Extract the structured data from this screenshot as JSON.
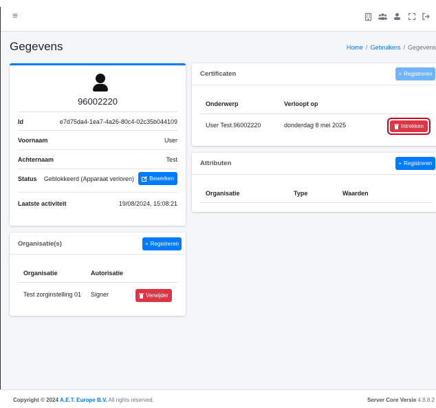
{
  "navbar": {
    "menu_icon": "≡",
    "icons": [
      {
        "name": "building-icon",
        "glyph": "▯"
      },
      {
        "name": "users-icon",
        "glyph": "👥"
      },
      {
        "name": "user-icon",
        "glyph": "●"
      },
      {
        "name": "expand-icon",
        "glyph": "⤢"
      },
      {
        "name": "logout-icon",
        "glyph": "⇥"
      }
    ]
  },
  "page": {
    "title": "Gegevens",
    "breadcrumb": {
      "home": "Home",
      "users": "Gebruikers",
      "current": "Gegevens"
    }
  },
  "profile": {
    "username": "96002220",
    "rows": {
      "id": {
        "label": "Id",
        "value": "e7d75da4-1ea7-4a26-80c4-02c35b044109"
      },
      "first_name": {
        "label": "Voornaam",
        "value": "User"
      },
      "last_name": {
        "label": "Achternaam",
        "value": "Test"
      },
      "status": {
        "label": "Status",
        "value": "Geblokkeerd (Apparaat verloren)",
        "edit_label": "Bewerken"
      },
      "last_activity": {
        "label": "Laatste activiteit",
        "value": "19/08/2024, 15:08:21"
      }
    }
  },
  "organisations": {
    "title": "Organisatie(s)",
    "register_label": "Registreren",
    "columns": [
      "Organisatie",
      "Autorisatie"
    ],
    "rows": [
      {
        "organisation": "Test zorginstelling 01",
        "authorisation": "Signer",
        "remove_label": "Verwijder"
      }
    ]
  },
  "certificates": {
    "title": "Certificaten",
    "register_label": "Registreren",
    "columns": [
      "Onderwerp",
      "Verloopt op"
    ],
    "rows": [
      {
        "subject": "User Test.96002220",
        "expires": "donderdag 8 mei 2025",
        "revoke_label": "Intrekken"
      }
    ]
  },
  "attributes": {
    "title": "Attributen",
    "register_label": "Registreren",
    "columns": [
      "Organisatie",
      "Type",
      "Waarden"
    ]
  },
  "footer": {
    "copyright_prefix": "Copyright © 2024",
    "company": "A.E.T. Europe B.V.",
    "rights": "All rights reserved.",
    "version_label": "Server Core Versie",
    "version": "4.8.8.2"
  },
  "colors": {
    "primary": "#007bff",
    "danger": "#dc3545",
    "highlight_outline": "#d0021b"
  }
}
